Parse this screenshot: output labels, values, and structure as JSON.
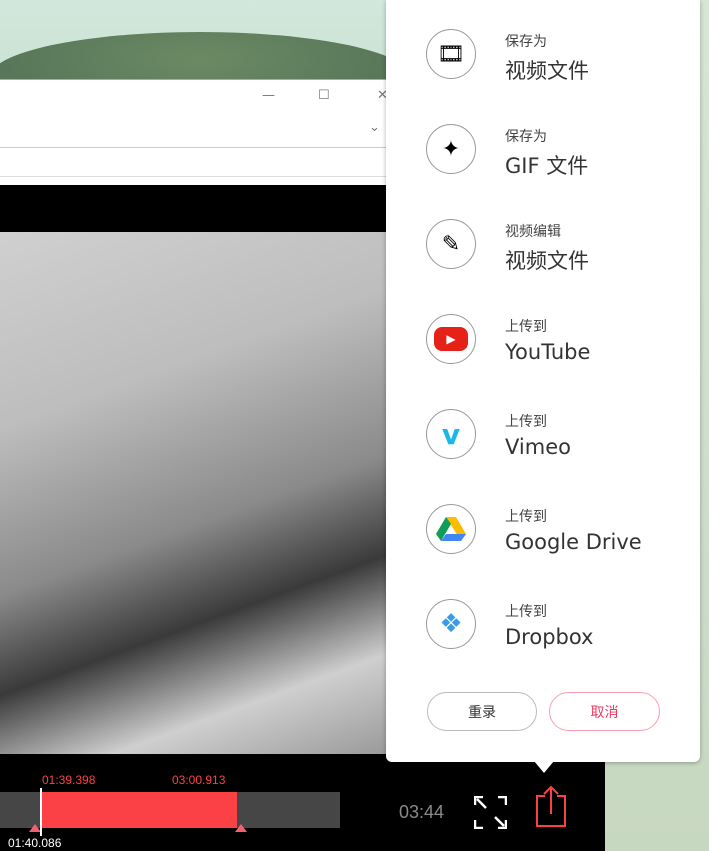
{
  "menu": {
    "items": [
      {
        "small": "保存为",
        "large": "视频文件",
        "icon": "film-reel-icon"
      },
      {
        "small": "保存为",
        "large": "GIF 文件",
        "icon": "gif-sparkle-icon"
      },
      {
        "small": "视频编辑",
        "large": "视频文件",
        "icon": "pencil-icon"
      },
      {
        "small": "上传到",
        "large": "YouTube",
        "icon": "youtube-icon"
      },
      {
        "small": "上传到",
        "large": "Vimeo",
        "icon": "vimeo-icon"
      },
      {
        "small": "上传到",
        "large": "Google Drive",
        "icon": "google-drive-icon"
      },
      {
        "small": "上传到",
        "large": "Dropbox",
        "icon": "dropbox-icon"
      }
    ],
    "rerecord_label": "重录",
    "cancel_label": "取消"
  },
  "timeline": {
    "start": "01:39.398",
    "end": "03:00.913",
    "current": "01:40.086",
    "duration": "03:44"
  },
  "colors": {
    "accent": "#fb4146"
  }
}
